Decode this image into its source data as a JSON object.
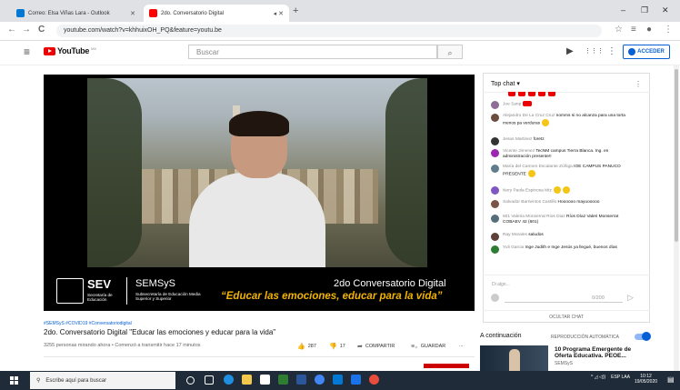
{
  "browser": {
    "tabs": [
      {
        "label": "Correo: Elsa Viñas Lara - Outlook",
        "favicon_color": "#0078d4"
      },
      {
        "label": "2do. Conversatorio Digital",
        "favicon_color": "#ff0000"
      }
    ],
    "tab_close": "✕",
    "tab_extra": "◂ ✕",
    "new_tab": "+",
    "window_controls": [
      "–",
      "❐",
      "✕"
    ],
    "nav": {
      "back": "←",
      "forward": "→",
      "reload": "C",
      "lock": "🔒"
    },
    "url": "youtube.com/watch?v=khhuixOH_PQ&feature=youtu.be",
    "toolbar_icons": [
      "☆",
      "≡",
      "●",
      "⋮"
    ]
  },
  "yt_header": {
    "menu_icon": "≡",
    "logo_text": "YouTube",
    "logo_cc": "MX",
    "search_placeholder": "Buscar",
    "search_icon": "⌕",
    "icons": [
      "▶",
      "⋮⋮⋮",
      "⋮"
    ],
    "signin_label": "ACCEDER"
  },
  "video_banner": {
    "sev": "SEV",
    "sev_sub": "Secretaría de Educación",
    "semsys": "SEMSyS",
    "semsys_sub": "Subsecretaría de Educación Media Superior y Superior",
    "event": "2do Conversatorio Digital",
    "motto": "“Educar las emociones, educar para la vida”"
  },
  "video_info": {
    "hashtags": "#SEMSyS #COVID19 #Conversatoriodigital",
    "title": "2do. Conversatorio Digital \"Educar las emociones y educar para la vida\"",
    "meta": "3255 personas mirando ahora • Comenzó a transmitir hace 17 minutos",
    "likes": "287",
    "dislikes": "17",
    "share_label": "COMPARTIR",
    "save_label": "GUARDAR",
    "more": "..."
  },
  "chat": {
    "title": "Top chat ▾",
    "menu": "⋮",
    "messages": [
      {
        "author": "Joe Sanp",
        "text": "",
        "avatar_color": "#8e6e95",
        "badge": "yt"
      },
      {
        "author": "Alejandro De La Cruz Cruz",
        "text": "nomms si no alcanza para una torta menos pa verduras",
        "avatar_color": "#6d4c41",
        "emoji": true
      },
      {
        "author": "Jesus Martinez",
        "text": "foretz",
        "avatar_color": "#333333"
      },
      {
        "author": "Vicente Jimenez",
        "text": "TecNM campus Tierra Blanca. Ing. en administración presente!!",
        "avatar_color": "#9c27b0"
      },
      {
        "author": "María del Carmen Escalante Zúñiga",
        "text": "IOE CAMPUS PANUCO PRESENTE",
        "avatar_color": "#607d8b",
        "emoji": true
      },
      {
        "author": "Nery Paola Espinosa Mtz",
        "text": "",
        "avatar_color": "#7e57c2",
        "emoji": true,
        "emoji2": true
      },
      {
        "author": "Salvador Barrientos Castillo",
        "text": "Hoooooo mayuooooo",
        "avatar_color": "#795548"
      },
      {
        "author": "601 Valeria Monserrat Rios Diaz",
        "text": "Ríos Díaz Valeri Monserrat COBAEV 42 (601)",
        "avatar_color": "#546e7a"
      },
      {
        "author": "Ray Morales",
        "text": "saludos",
        "avatar_color": "#5d4037"
      },
      {
        "author": "Yuli Garcia",
        "text": "Inge Judith e Inge Jesús ya llegué, buenos días",
        "avatar_color": "#2e7d32"
      }
    ],
    "input_placeholder": "Di algo...",
    "counter": "0/200",
    "send_icon": "▷",
    "hide_label": "OCULTAR CHAT"
  },
  "up_next": {
    "continue_label": "A continuación",
    "autoplay_label": "REPRODUCCIÓN AUTOMÁTICA",
    "video_title": "10 Programa Emergente de Oferta Educativa. PEOE...",
    "channel": "SEMSyS"
  },
  "taskbar": {
    "search_placeholder": "Escribe aquí para buscar",
    "search_icon": "⚲",
    "tray": "^ ◿ ◁))",
    "lang": "ESP LAA",
    "time": "10:12",
    "date": "19/05/2020",
    "notif_icon": "▤"
  }
}
